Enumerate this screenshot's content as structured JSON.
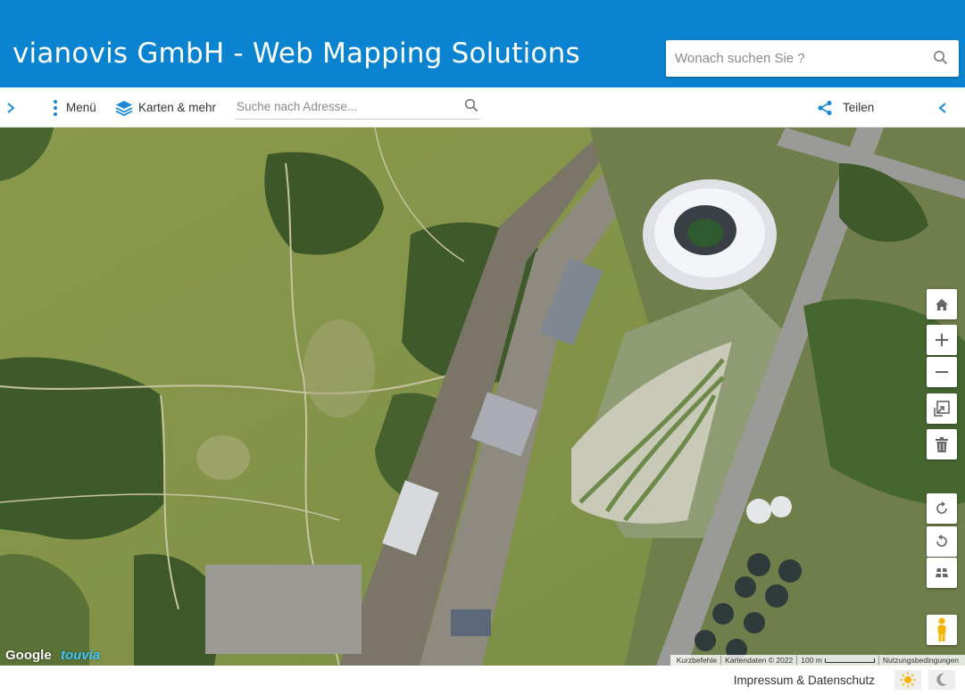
{
  "header": {
    "title": "vianovis GmbH - Web Mapping Solutions",
    "search_placeholder": "Wonach suchen Sie ?"
  },
  "toolbar": {
    "menu_label": "Menü",
    "maps_label": "Karten & mehr",
    "address_placeholder": "Suche nach Adresse...",
    "share_label": "Teilen"
  },
  "map": {
    "google_logo": "Google",
    "touvia_logo": "touvia",
    "attribution": {
      "shortcuts": "Kurzbefehle",
      "map_data": "Kartendaten © 2022",
      "scale": "100 m",
      "terms": "Nutzungsbedingungen"
    },
    "controls": [
      "home-icon",
      "zoom-in-icon",
      "zoom-out-icon",
      "export-icon",
      "trash-icon",
      "rotate-right-icon",
      "rotate-left-icon",
      "tilt-icon",
      "pegman-icon"
    ]
  },
  "footer": {
    "imprint_label": "Impressum & Datenschutz"
  },
  "colors": {
    "brand_blue": "#0a84d0",
    "accent_blue": "#1a8ad4",
    "pegman_yellow": "#f5b400"
  }
}
